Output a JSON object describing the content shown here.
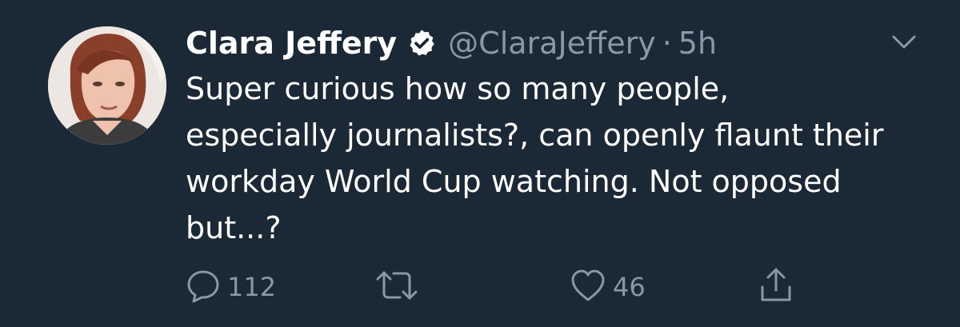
{
  "tweet": {
    "author": {
      "display_name": "Clara Jeffery",
      "handle": "@ClaraJeffery",
      "verified": true
    },
    "separator": "·",
    "time": "5h",
    "text": "Super curious how so many people, especially journalists?, can openly flaunt their workday World Cup watching. Not opposed but...?",
    "actions": {
      "reply_count": "112",
      "retweet_count": "",
      "like_count": "46"
    }
  },
  "colors": {
    "background": "#1b2836",
    "text": "#ffffff",
    "muted": "#8899a6"
  },
  "icons": [
    "avatar",
    "verified-badge-icon",
    "chevron-down-icon",
    "reply-icon",
    "retweet-icon",
    "like-icon",
    "share-icon"
  ]
}
